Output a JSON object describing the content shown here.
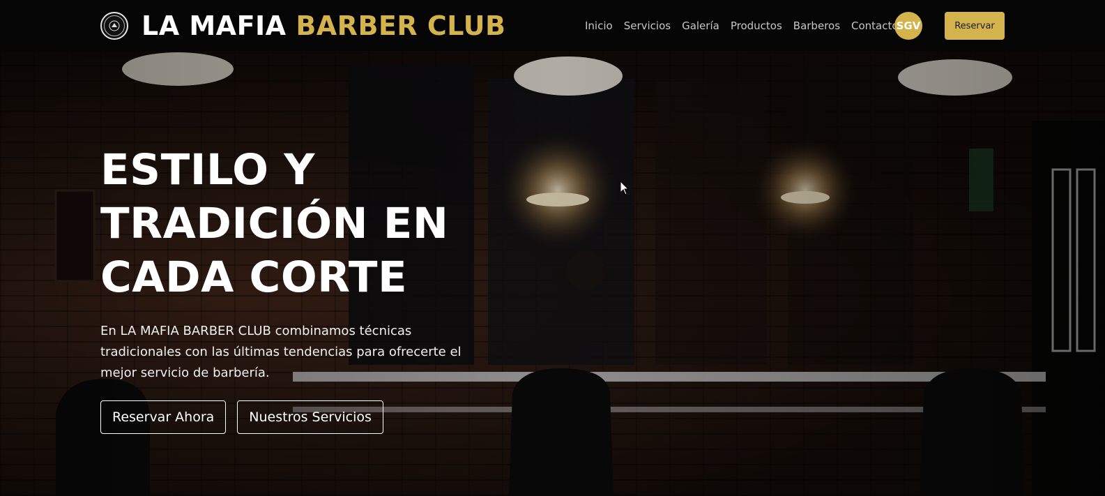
{
  "brand": {
    "logo_icon": "barber-club-emblem",
    "name_white": "LA MAFIA ",
    "name_gold": "BARBER CLUB"
  },
  "nav": {
    "links": [
      "Inicio",
      "Servicios",
      "Galería",
      "Productos",
      "Barberos",
      "Contacto"
    ],
    "user_initials": "SGV",
    "reserve_label": "Reservar"
  },
  "hero": {
    "title_lines": [
      "ESTILO Y",
      "TRADICIÓN EN",
      "CADA CORTE"
    ],
    "subtitle": "En LA MAFIA BARBER CLUB combinamos técnicas tradicionales con las últimas tendencias para ofrecerte el mejor servicio de barbería.",
    "primary_button": "Reservar Ahora",
    "secondary_button": "Nuestros Servicios"
  },
  "colors": {
    "accent": "#d4b24c",
    "navbar": "#050505",
    "text": "#ffffff"
  }
}
